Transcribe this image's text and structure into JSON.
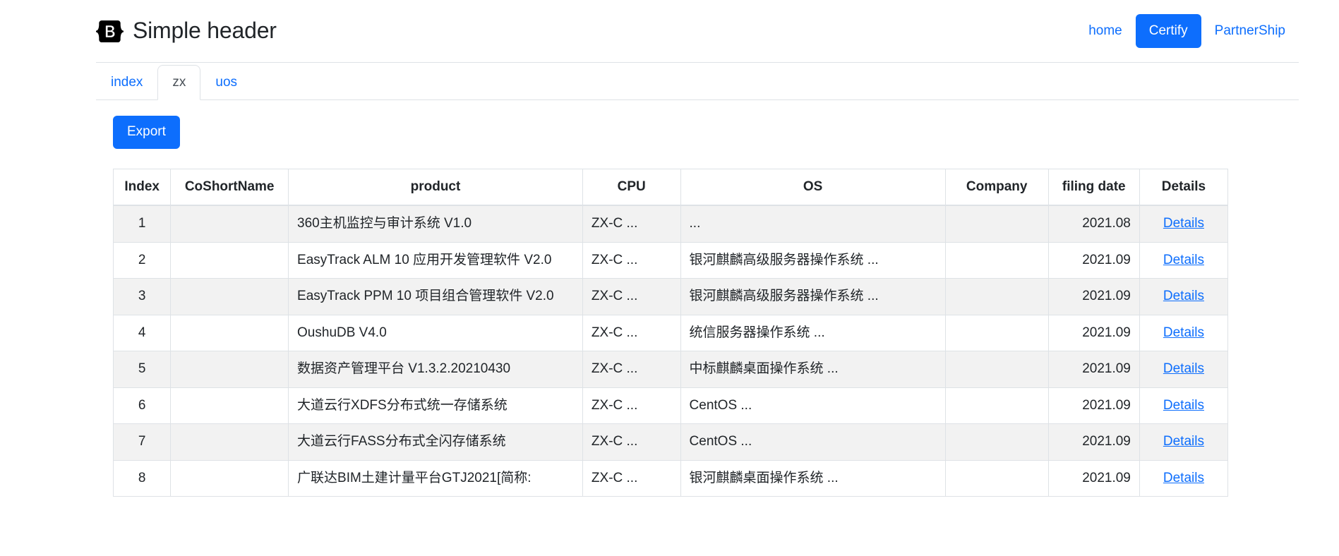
{
  "header": {
    "logo_icon": "bootstrap-logo-icon",
    "title": "Simple header",
    "nav": [
      {
        "label": "home",
        "active": false
      },
      {
        "label": "Certify",
        "active": true
      },
      {
        "label": "PartnerShip",
        "active": false
      }
    ]
  },
  "tabs": [
    {
      "label": "index",
      "active": false
    },
    {
      "label": "zx",
      "active": true
    },
    {
      "label": "uos",
      "active": false
    }
  ],
  "toolbar": {
    "export_label": "Export"
  },
  "table": {
    "columns": [
      "Index",
      "CoShortName",
      "product",
      "CPU",
      "OS",
      "Company",
      "filing date",
      "Details"
    ],
    "rows": [
      {
        "index": "1",
        "coshortname": "",
        "product": "360主机监控与审计系统 V1.0",
        "cpu": "ZX-C ...",
        "os": "...",
        "company": "",
        "filing_date": "2021.08",
        "details": "Details"
      },
      {
        "index": "2",
        "coshortname": "",
        "product": "EasyTrack ALM 10 应用开发管理软件 V2.0",
        "cpu": "ZX-C ...",
        "os": "银河麒麟高级服务器操作系统 ...",
        "company": "",
        "filing_date": "2021.09",
        "details": "Details"
      },
      {
        "index": "3",
        "coshortname": "",
        "product": "EasyTrack PPM 10 项目组合管理软件 V2.0",
        "cpu": "ZX-C ...",
        "os": "银河麒麟高级服务器操作系统 ...",
        "company": "",
        "filing_date": "2021.09",
        "details": "Details"
      },
      {
        "index": "4",
        "coshortname": "",
        "product": "OushuDB V4.0",
        "cpu": "ZX-C ...",
        "os": "统信服务器操作系统 ...",
        "company": "",
        "filing_date": "2021.09",
        "details": "Details"
      },
      {
        "index": "5",
        "coshortname": "",
        "product": "数据资产管理平台 V1.3.2.20210430",
        "cpu": "ZX-C ...",
        "os": "中标麒麟桌面操作系统 ...",
        "company": "",
        "filing_date": "2021.09",
        "details": "Details"
      },
      {
        "index": "6",
        "coshortname": "",
        "product": "大道云行XDFS分布式统一存储系统",
        "cpu": "ZX-C ...",
        "os": "CentOS ...",
        "company": "",
        "filing_date": "2021.09",
        "details": "Details"
      },
      {
        "index": "7",
        "coshortname": "",
        "product": "大道云行FASS分布式全闪存储系统",
        "cpu": "ZX-C ...",
        "os": "CentOS ...",
        "company": "",
        "filing_date": "2021.09",
        "details": "Details"
      },
      {
        "index": "8",
        "coshortname": "",
        "product": "广联达BIM土建计量平台GTJ2021[简称:",
        "cpu": "ZX-C ...",
        "os": "银河麒麟桌面操作系统 ...",
        "company": "",
        "filing_date": "2021.09",
        "details": "Details"
      }
    ]
  },
  "colors": {
    "accent": "#0d6efd",
    "link": "#0d6efd",
    "border": "#dee2e6",
    "stripe": "#f2f2f2",
    "text": "#212529",
    "tab_active_text": "#495057"
  }
}
